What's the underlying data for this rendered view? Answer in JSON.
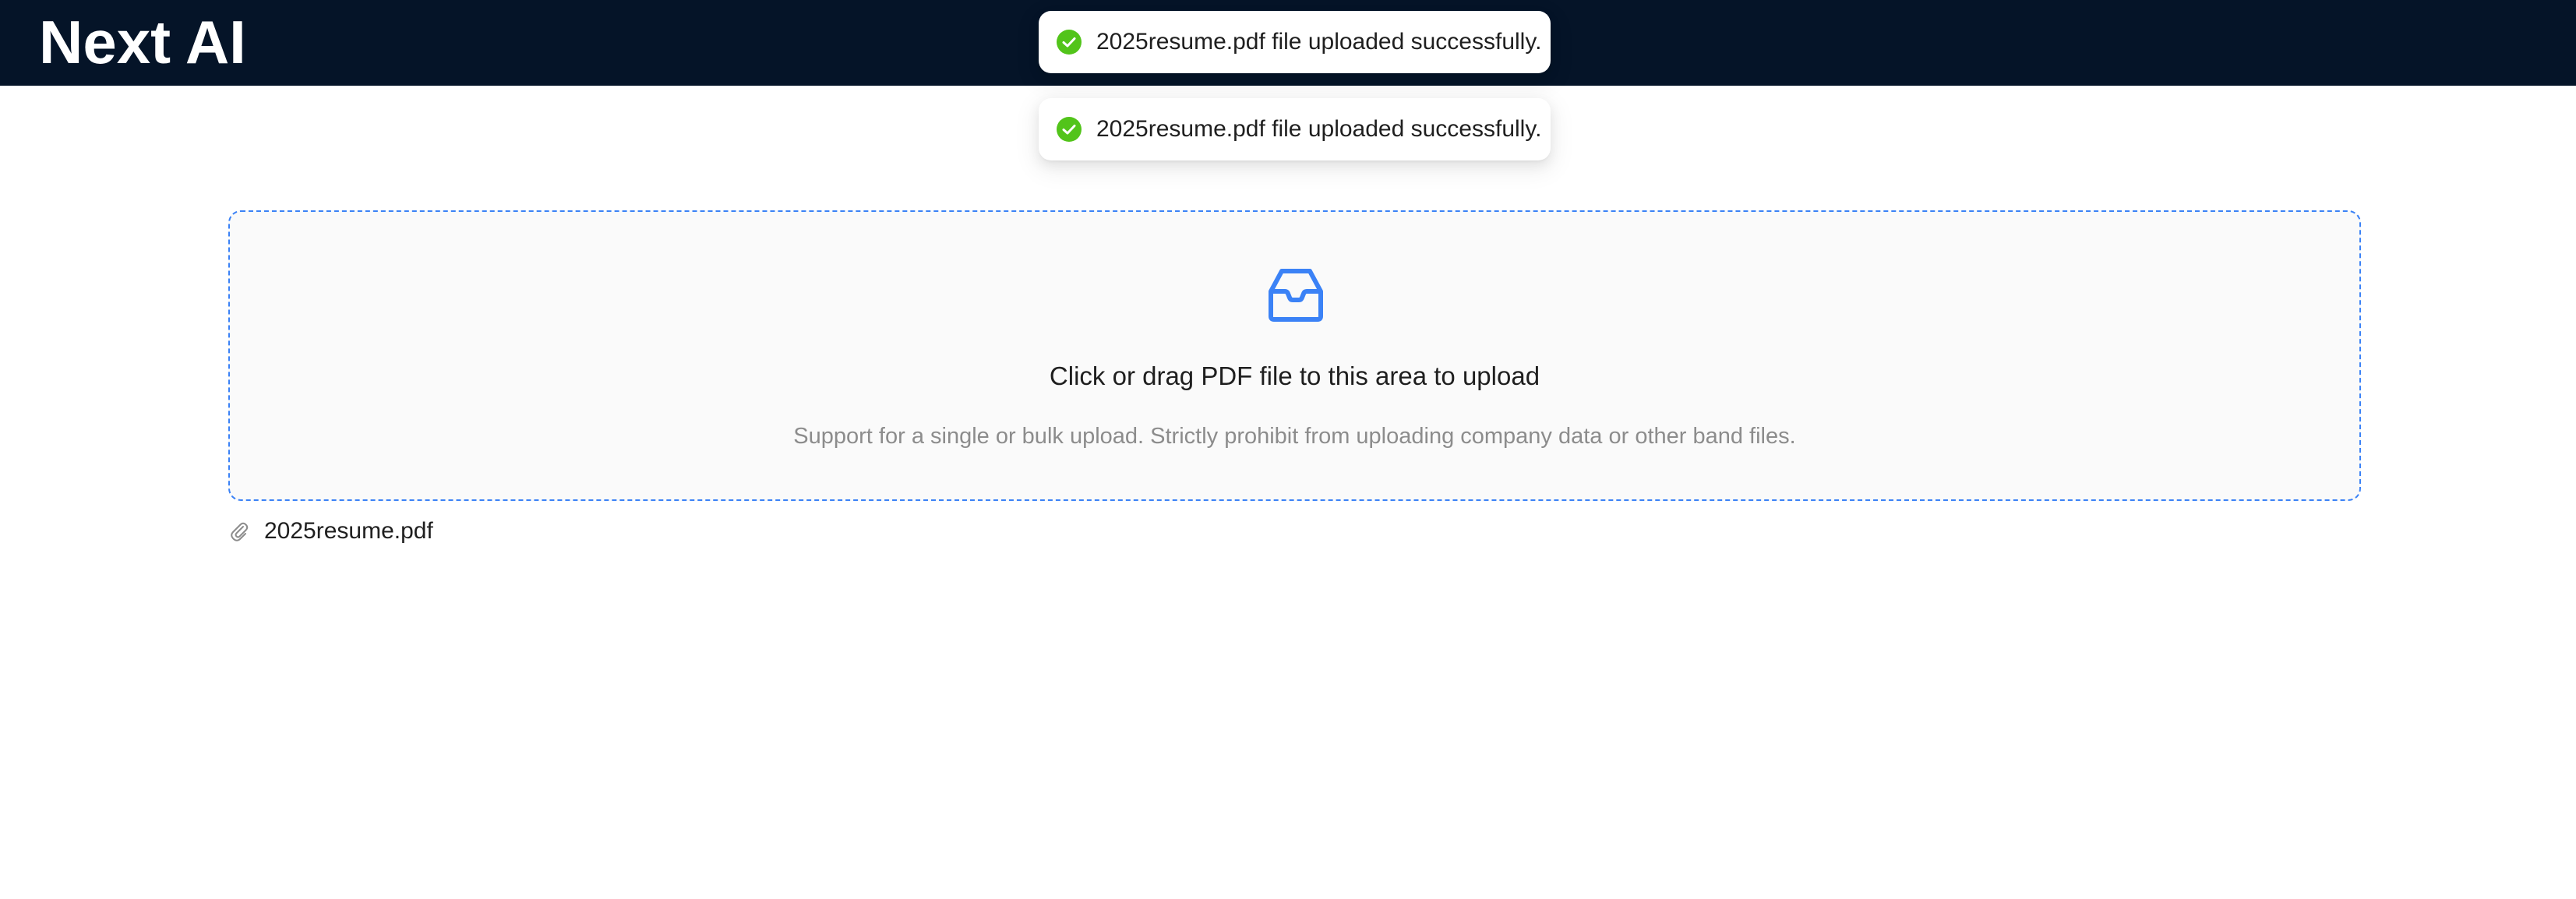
{
  "app": {
    "brand": "Next AI"
  },
  "toasts": [
    {
      "message": "2025resume.pdf file uploaded successfully.",
      "icon": "check-circle-icon",
      "status_color": "#52c41a"
    },
    {
      "message": "2025resume.pdf file uploaded successfully.",
      "icon": "check-circle-icon",
      "status_color": "#52c41a"
    }
  ],
  "upload": {
    "icon": "inbox-icon",
    "title": "Click or drag PDF file to this area to upload",
    "hint": "Support for a single or bulk upload. Strictly prohibit from uploading company data or other band files.",
    "accent_color": "#3b82f6"
  },
  "files": [
    {
      "name": "2025resume.pdf",
      "icon": "paperclip-icon"
    }
  ]
}
